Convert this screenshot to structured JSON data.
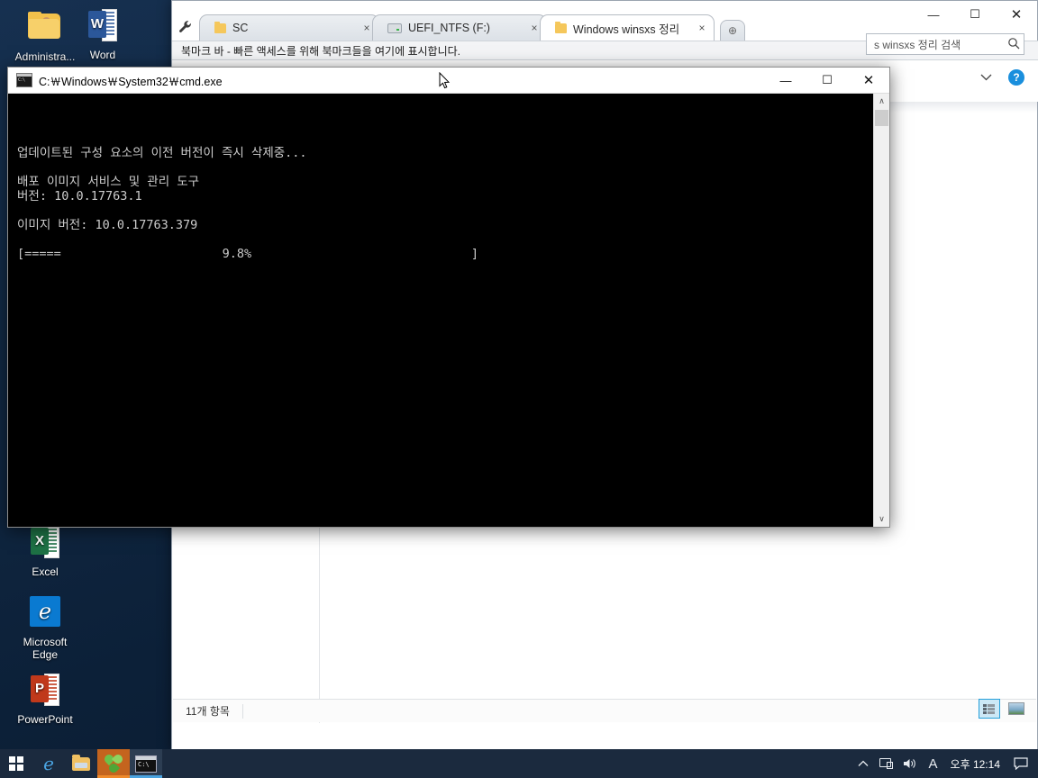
{
  "desktop": {
    "icons": [
      {
        "name": "Administra...",
        "icon": "folder-user-icon"
      },
      {
        "name": "Word",
        "icon": "word-icon"
      },
      {
        "name": "Excel",
        "icon": "excel-icon"
      },
      {
        "name": "Microsoft\nEdge",
        "icon": "edge-icon"
      },
      {
        "name": "PowerPoint",
        "icon": "powerpoint-icon"
      }
    ]
  },
  "explorer": {
    "wrench_icon": "wrench-icon",
    "tabs": [
      {
        "label": "SC",
        "icon": "folder-icon",
        "close": "×",
        "active": false
      },
      {
        "label": "UEFI_NTFS (F:)",
        "icon": "drive-icon",
        "close": "×",
        "active": false
      },
      {
        "label": "Windows winsxs 정리",
        "icon": "folder-icon",
        "close": "×",
        "active": true
      }
    ],
    "newtab_label": "⊕",
    "bookmark_bar": "북마크 바 - 빠른 액세스를 위해 북마크들을 여기에 표시합니다.",
    "search_value": "s winsxs 정리 검색",
    "search_icon": "search-icon",
    "ribbon_collapse_icon": "chevron-down-icon",
    "help_label": "?",
    "status_items": "11개 항목",
    "view_details_icon": "details-view-icon",
    "view_large_icon": "large-icons-view-icon",
    "window_buttons": {
      "minimize": "—",
      "maximize": "☐",
      "close": "✕"
    }
  },
  "cmd": {
    "title": "C:\\Windows\\System32\\cmd.exe",
    "title_display": "C:￦Windows￦System32￦cmd.exe",
    "icon": "console-icon",
    "window_buttons": {
      "minimize": "—",
      "maximize": "☐",
      "close": "✕"
    },
    "lines": [
      "",
      "",
      "",
      "업데이트된 구성 요소의 이전 버전이 즉시 삭제중...",
      "",
      "배포 이미지 서비스 및 관리 도구",
      "버전: 10.0.17763.1",
      "",
      "이미지 버전: 10.0.17763.379",
      "",
      "[=====                      9.8%                              ]"
    ],
    "progress_percent": "9.8%",
    "dism_version": "10.0.17763.1",
    "image_version": "10.0.17763.379",
    "scrollbar": {
      "up": "∧",
      "down": "∨"
    }
  },
  "taskbar": {
    "start_icon": "windows-start-icon",
    "items": [
      {
        "icon": "edge-icon",
        "running": false
      },
      {
        "icon": "file-explorer-icon",
        "running": false
      },
      {
        "icon": "clover-icon",
        "running": true
      },
      {
        "icon": "cmd-icon",
        "running": true
      }
    ],
    "tray": {
      "chevron_icon": "chevron-up-icon",
      "network_icon": "network-icon",
      "volume_icon": "volume-icon",
      "ime_label": "A",
      "clock": "오후 12:14",
      "action_center_icon": "action-center-icon"
    }
  }
}
